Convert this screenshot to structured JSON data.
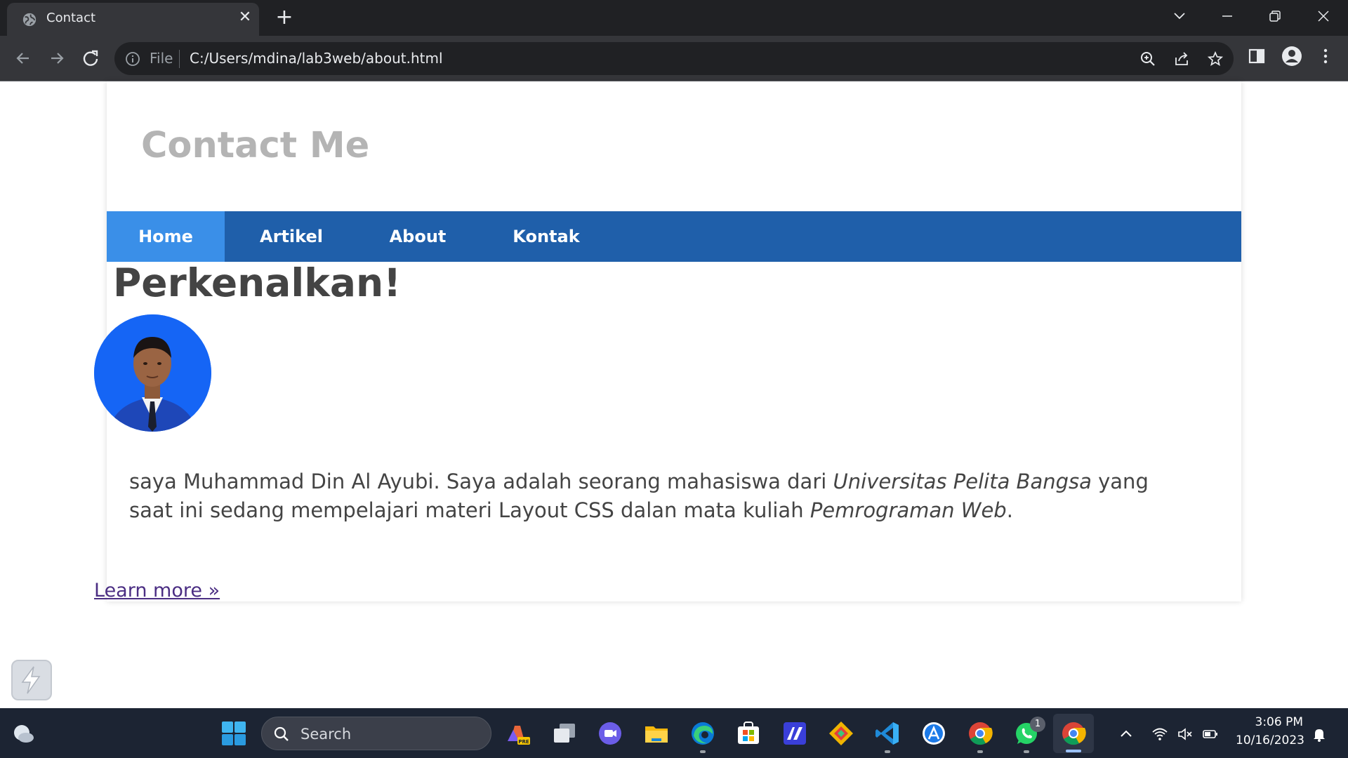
{
  "browser": {
    "tab_title": "Contact",
    "url_scheme": "File",
    "url": "C:/Users/mdina/lab3web/about.html"
  },
  "site": {
    "header_title": "Contact Me",
    "nav": [
      {
        "label": "Home",
        "active": true
      },
      {
        "label": "Artikel",
        "active": false
      },
      {
        "label": "About",
        "active": false
      },
      {
        "label": "Kontak",
        "active": false
      }
    ],
    "heading": "Perkenalkan!",
    "about_prefix": "saya Muhammad Din Al Ayubi. Saya adalah seorang mahasiswa dari ",
    "about_em1": "Universitas Pelita Bangsa",
    "about_middle": " yang saat ini sedang mempelajari materi Layout CSS dalan mata kuliah ",
    "about_em2": "Pemrograman Web",
    "about_suffix": ".",
    "learn_more": "Learn more »"
  },
  "taskbar": {
    "search_label": "Search",
    "whatsapp_badge": "1",
    "time": "3:06 PM",
    "date": "10/16/2023"
  },
  "colors": {
    "nav_bg": "#1f5faa",
    "nav_active": "#3a8fe8",
    "header_text": "#b4b4b4",
    "body_text": "#444444",
    "link": "#4b2e83"
  }
}
